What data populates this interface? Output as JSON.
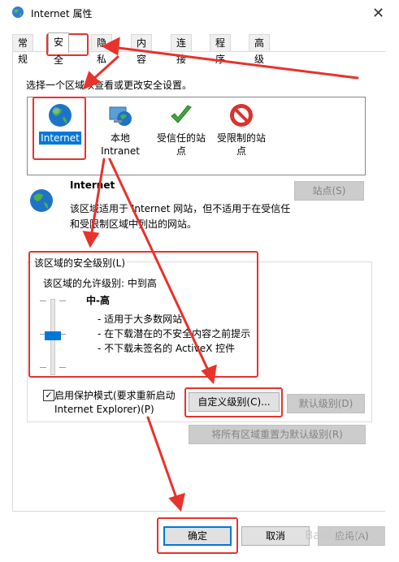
{
  "window": {
    "title": "Internet 属性",
    "close_glyph": "✕",
    "icon": "internet-options-icon"
  },
  "tabs": [
    {
      "label": "常规",
      "active": false
    },
    {
      "label": "安全",
      "active": true
    },
    {
      "label": "隐私",
      "active": false
    },
    {
      "label": "内容",
      "active": false
    },
    {
      "label": "连接",
      "active": false
    },
    {
      "label": "程序",
      "active": false
    },
    {
      "label": "高级",
      "active": false
    }
  ],
  "security": {
    "zone_prompt": "选择一个区域以查看或更改安全设置。",
    "zones": [
      {
        "label": "Internet",
        "icon": "globe-icon",
        "selected": true
      },
      {
        "label": "本地 Intranet",
        "icon": "intranet-icon",
        "selected": false
      },
      {
        "label": "受信任的站点",
        "icon": "checkmark-icon",
        "selected": false
      },
      {
        "label": "受限制的站点",
        "icon": "restricted-icon",
        "selected": false
      }
    ],
    "zone_name": "Internet",
    "zone_desc": "该区域适用于 Internet 网站，但不适用于在受信任和受限制区域中列出的网站。",
    "sites_button": "站点(S)",
    "level_group_title": "该区域的安全级别(L)",
    "allowed_level": "该区域的允许级别: 中到高",
    "level_name": "中-高",
    "slider_level": 0.5,
    "bullets": [
      "- 适用于大多数网站",
      "- 在下载潜在的不安全内容之前提示",
      "- 不下载未签名的 ActiveX 控件"
    ],
    "protected_mode_checked": true,
    "check_glyph": "✓",
    "protected_mode_label": "启用保护模式(要求重新启动 Internet Explorer)(P)",
    "custom_level_button": "自定义级别(C)...",
    "default_level_button": "默认级别(D)",
    "reset_all_button": "将所有区域重置为默认级别(R)"
  },
  "footer": {
    "ok_button": "确定",
    "cancel_button": "取消",
    "apply_button": "应用(A)"
  },
  "watermark": "Baidu经验",
  "colors": {
    "accent": "#0078d7",
    "annotation_red": "#e8322c",
    "disabled_text": "#838383"
  }
}
